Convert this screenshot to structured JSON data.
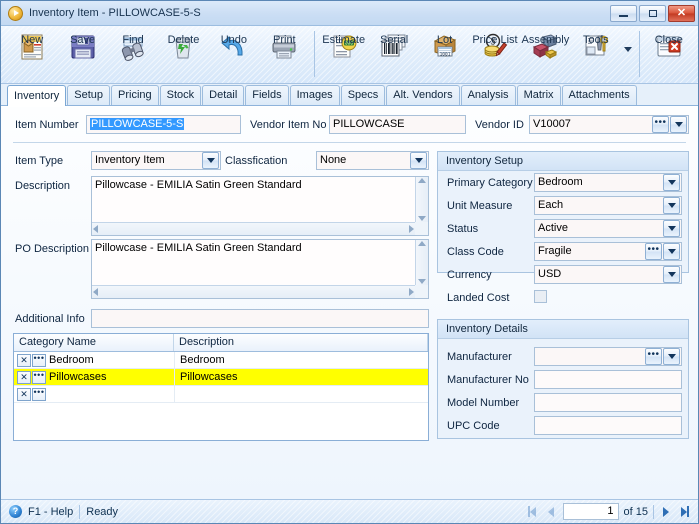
{
  "window": {
    "title": "Inventory Item - PILLOWCASE-5-S",
    "icon": "play-circle-icon",
    "controls": {
      "minimize": "minimize-button",
      "maximize": "maximize-button",
      "close": "close-button"
    }
  },
  "toolbar": {
    "buttons": [
      {
        "label": "New",
        "icon": "new-document-icon"
      },
      {
        "label": "Save",
        "icon": "floppy-disk-icon"
      },
      {
        "label": "Find",
        "icon": "binoculars-icon"
      },
      {
        "label": "Delete",
        "icon": "trash-recycle-icon"
      },
      {
        "label": "Undo",
        "icon": "undo-arrow-icon"
      },
      {
        "label": "Print",
        "icon": "printer-icon"
      },
      {
        "label": "Estimate",
        "icon": "estimate-calculator-icon"
      },
      {
        "label": "Serial",
        "icon": "barcode-serial-icon"
      },
      {
        "label": "Lot",
        "icon": "lot-box-icon"
      },
      {
        "label": "Price List",
        "icon": "price-tag-dollar-icon"
      },
      {
        "label": "Assembly",
        "icon": "assembly-blocks-icon"
      },
      {
        "label": "Tools",
        "icon": "tools-wrench-icon",
        "has_dropdown": true
      },
      {
        "label": "Close",
        "icon": "close-window-icon"
      }
    ]
  },
  "tabs": [
    {
      "label": "Inventory",
      "active": true
    },
    {
      "label": "Setup",
      "active": false
    },
    {
      "label": "Pricing",
      "active": false
    },
    {
      "label": "Stock",
      "active": false
    },
    {
      "label": "Detail",
      "active": false
    },
    {
      "label": "Fields",
      "active": false
    },
    {
      "label": "Images",
      "active": false
    },
    {
      "label": "Specs",
      "active": false
    },
    {
      "label": "Alt. Vendors",
      "active": false
    },
    {
      "label": "Analysis",
      "active": false
    },
    {
      "label": "Matrix",
      "active": false
    },
    {
      "label": "Attachments",
      "active": false
    }
  ],
  "form": {
    "item_number": {
      "label": "Item Number",
      "value": "PILLOWCASE-5-S",
      "selected": true
    },
    "vendor_item_no": {
      "label": "Vendor Item No",
      "value": "PILLOWCASE"
    },
    "vendor_id": {
      "label": "Vendor ID",
      "value": "V10007"
    },
    "item_type": {
      "label": "Item Type",
      "value": "Inventory Item"
    },
    "classification": {
      "label": "Classfication",
      "value": "None"
    },
    "description": {
      "label": "Description",
      "value": "Pillowcase - EMILIA Satin Green Standard"
    },
    "po_description": {
      "label": "PO Description",
      "value": "Pillowcase - EMILIA Satin Green Standard"
    },
    "additional_info": {
      "label": "Additional Info",
      "value": ""
    }
  },
  "inventory_setup": {
    "title": "Inventory Setup",
    "primary_category": {
      "label": "Primary Category",
      "value": "Bedroom"
    },
    "unit_measure": {
      "label": "Unit Measure",
      "value": "Each"
    },
    "status": {
      "label": "Status",
      "value": "Active"
    },
    "class_code": {
      "label": "Class Code",
      "value": "Fragile"
    },
    "currency": {
      "label": "Currency",
      "value": "USD"
    },
    "landed_cost": {
      "label": "Landed Cost",
      "checked": false
    }
  },
  "inventory_details": {
    "title": "Inventory Details",
    "manufacturer": {
      "label": "Manufacturer",
      "value": ""
    },
    "manufacturer_no": {
      "label": "Manufacturer No",
      "value": ""
    },
    "model_number": {
      "label": "Model Number",
      "value": ""
    },
    "upc_code": {
      "label": "UPC Code",
      "value": ""
    }
  },
  "category_grid": {
    "columns": [
      "Category Name",
      "Description"
    ],
    "rows": [
      {
        "name": "Bedroom",
        "description": "Bedroom",
        "highlighted": false
      },
      {
        "name": "Pillowcases",
        "description": "Pillowcases",
        "highlighted": true
      },
      {
        "name": "",
        "description": "",
        "highlighted": false
      }
    ],
    "row_buttons": {
      "delete": "X",
      "lookup": "..."
    }
  },
  "statusbar": {
    "help": "F1 - Help",
    "status": "Ready",
    "record_number": "1",
    "of_text": "of 15",
    "nav": {
      "first": "first-record-button",
      "previous": "previous-record-button",
      "next": "next-record-button",
      "last": "last-record-button"
    }
  },
  "colors": {
    "titlebar": "#cbdef4",
    "accent_blue": "#2f6fb5",
    "highlight_row": "#ffff00",
    "selection_blue": "#3399ff",
    "close_red": "#c23a22"
  }
}
